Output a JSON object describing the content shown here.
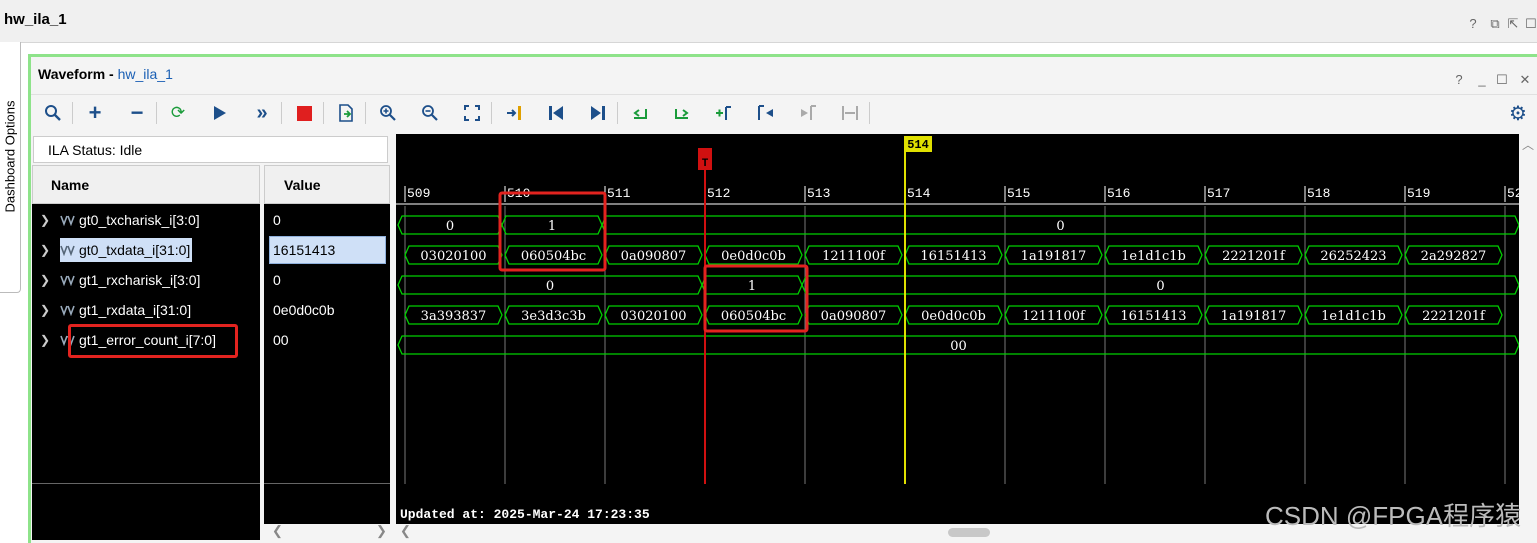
{
  "window": {
    "title": "hw_ila_1"
  },
  "sidebar": {
    "label": "Dashboard Options"
  },
  "panel": {
    "title_prefix": "Waveform - ",
    "title_link": "hw_ila_1"
  },
  "ila_status": "ILA Status:  Idle",
  "columns": {
    "name": "Name",
    "value": "Value"
  },
  "signals": [
    {
      "name": "gt0_txcharisk_i[3:0]",
      "value": "0"
    },
    {
      "name": "gt0_txdata_i[31:0]",
      "value": "16151413"
    },
    {
      "name": "gt1_rxcharisk_i[3:0]",
      "value": "0"
    },
    {
      "name": "gt1_rxdata_i[31:0]",
      "value": "0e0d0c0b"
    },
    {
      "name": "gt1_error_count_i[7:0]",
      "value": "00"
    }
  ],
  "timeline": {
    "ticks": [
      "509",
      "510",
      "511",
      "512",
      "513",
      "514",
      "515",
      "516",
      "517",
      "518",
      "519",
      "52"
    ],
    "cursor_marker": "514",
    "trigger_marker": "T"
  },
  "waveforms": {
    "txcharisk": [
      "0",
      "1",
      "0"
    ],
    "txdata": [
      "03020100",
      "060504bc",
      "0a090807",
      "0e0d0c0b",
      "1211100f",
      "16151413",
      "1a191817",
      "1e1d1c1b",
      "2221201f",
      "26252423",
      "2a292827"
    ],
    "rxcharisk": [
      "0",
      "1",
      "0"
    ],
    "rxdata": [
      "3a393837",
      "3e3d3c3b",
      "03020100",
      "060504bc",
      "0a090807",
      "0e0d0c0b",
      "1211100f",
      "16151413",
      "1a191817",
      "1e1d1c1b",
      "2221201f"
    ],
    "error_count": [
      "00"
    ]
  },
  "updated": "Updated at: 2025-Mar-24 17:23:35",
  "watermark": "CSDN @FPGA程序猿",
  "colors": {
    "wave": "#00d000",
    "cursor": "#e0e000",
    "trigger": "#d01010",
    "highlight": "#e3231f",
    "panel_border": "#8ee38a"
  }
}
